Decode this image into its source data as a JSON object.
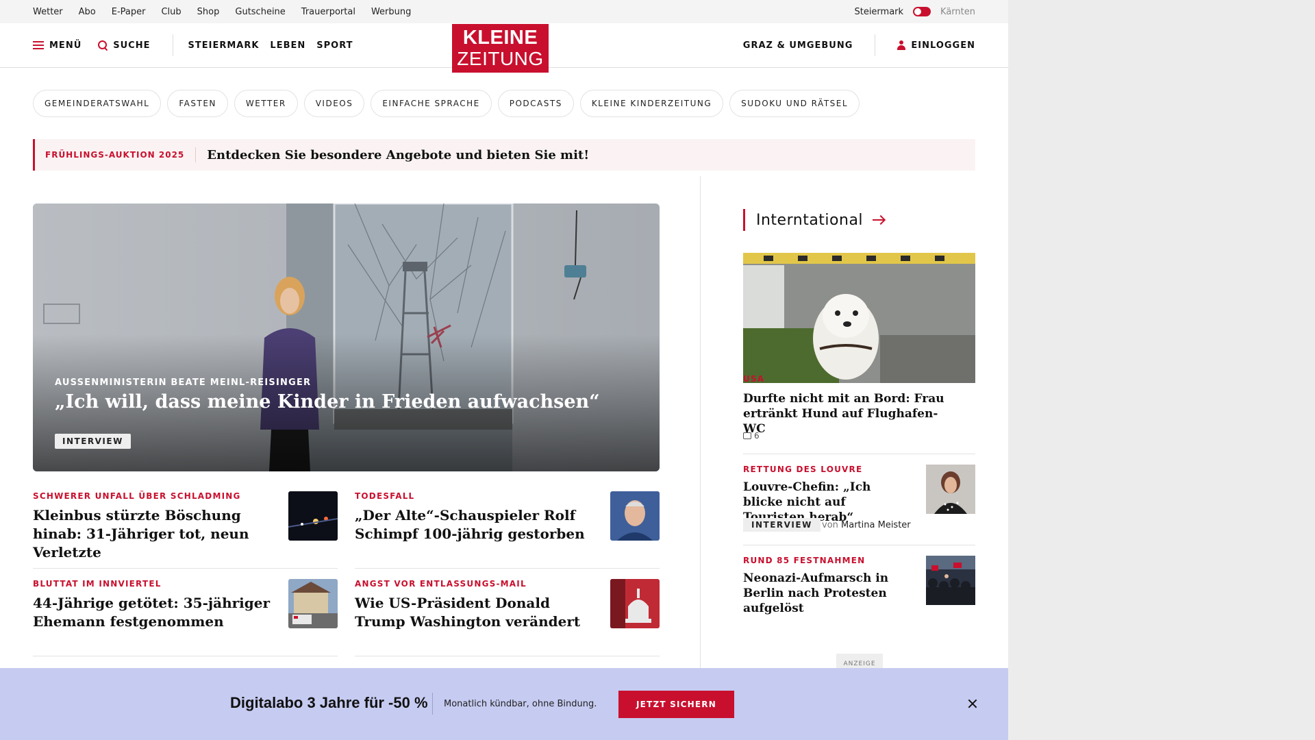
{
  "utility": {
    "links": [
      "Wetter",
      "Abo",
      "E-Paper",
      "Club",
      "Shop",
      "Gutscheine",
      "Trauerportal",
      "Werbung"
    ],
    "region_active": "Steiermark",
    "region_other": "Kärnten"
  },
  "header": {
    "menu_label": "MENÜ",
    "search_label": "SUCHE",
    "nav": [
      "STEIERMARK",
      "LEBEN",
      "SPORT"
    ],
    "logo_line1": "KLEINE",
    "logo_line2": "ZEITUNG",
    "local_label": "GRAZ & UMGEBUNG",
    "login_label": "EINLOGGEN",
    "accent_color": "#c8102e"
  },
  "chips": [
    "GEMEINDERATSWAHL",
    "FASTEN",
    "WETTER",
    "VIDEOS",
    "EINFACHE SPRACHE",
    "PODCASTS",
    "KLEINE KINDERZEITUNG",
    "SUDOKU UND RÄTSEL"
  ],
  "promo": {
    "kicker": "FRÜHLINGS-AUKTION 2025",
    "text": "Entdecken Sie besondere Angebote und bieten Sie mit!"
  },
  "hero": {
    "kicker": "AUSSENMINISTERIN BEATE MEINL-REISINGER",
    "title": "„Ich will, dass meine Kinder in Frieden aufwachsen“",
    "badge": "INTERVIEW"
  },
  "articles": [
    {
      "kicker": "SCHWERER UNFALL ÜBER SCHLADMING",
      "title": "Kleinbus stürzte Böschung hinab: 31-Jähriger tot, neun Verletzte",
      "thumb": "night-road-photo"
    },
    {
      "kicker": "TODESFALL",
      "title": "„Der Alte“-Schauspieler Rolf Schimpf 100-jährig gestorben",
      "thumb": "portrait-photo"
    },
    {
      "kicker": "BLUTTAT IM INNVIERTEL",
      "title": "44-Jährige getötet: 35-jähriger Ehemann festgenommen",
      "thumb": "house-police-photo"
    },
    {
      "kicker": "ANGST VOR ENTLASSUNGS-MAIL",
      "title": "Wie US-Präsident Donald Trump Washington verändert",
      "thumb": "capitol-photo"
    }
  ],
  "sidebar": {
    "section_title": "Interntational",
    "lead": {
      "kicker": "USA",
      "title": "Durfte nicht mit an Bord: Frau ertränkt Hund auf Flughafen-WC",
      "comments": "6",
      "image": "terrier-dog-photo"
    },
    "items": [
      {
        "kicker": "RETTUNG DES LOUVRE",
        "title": "Louvre-Chefin: „Ich blicke nicht auf Touristen herab“",
        "badge": "INTERVIEW",
        "author_prefix": "von",
        "author": "Martina Meister",
        "thumb": "woman-portrait-photo"
      },
      {
        "kicker": "RUND 85 FESTNAHMEN",
        "title": "Neonazi-Aufmarsch in Berlin nach Protesten aufgelöst",
        "thumb": "protest-crowd-photo"
      }
    ],
    "ad_label": "ANZEIGE"
  },
  "offer": {
    "title": "Digitalabo 3 Jahre für -50 %",
    "subtitle": "Monatlich kündbar, ohne Bindung.",
    "button": "JETZT SICHERN",
    "background": "#c6cbf1"
  }
}
